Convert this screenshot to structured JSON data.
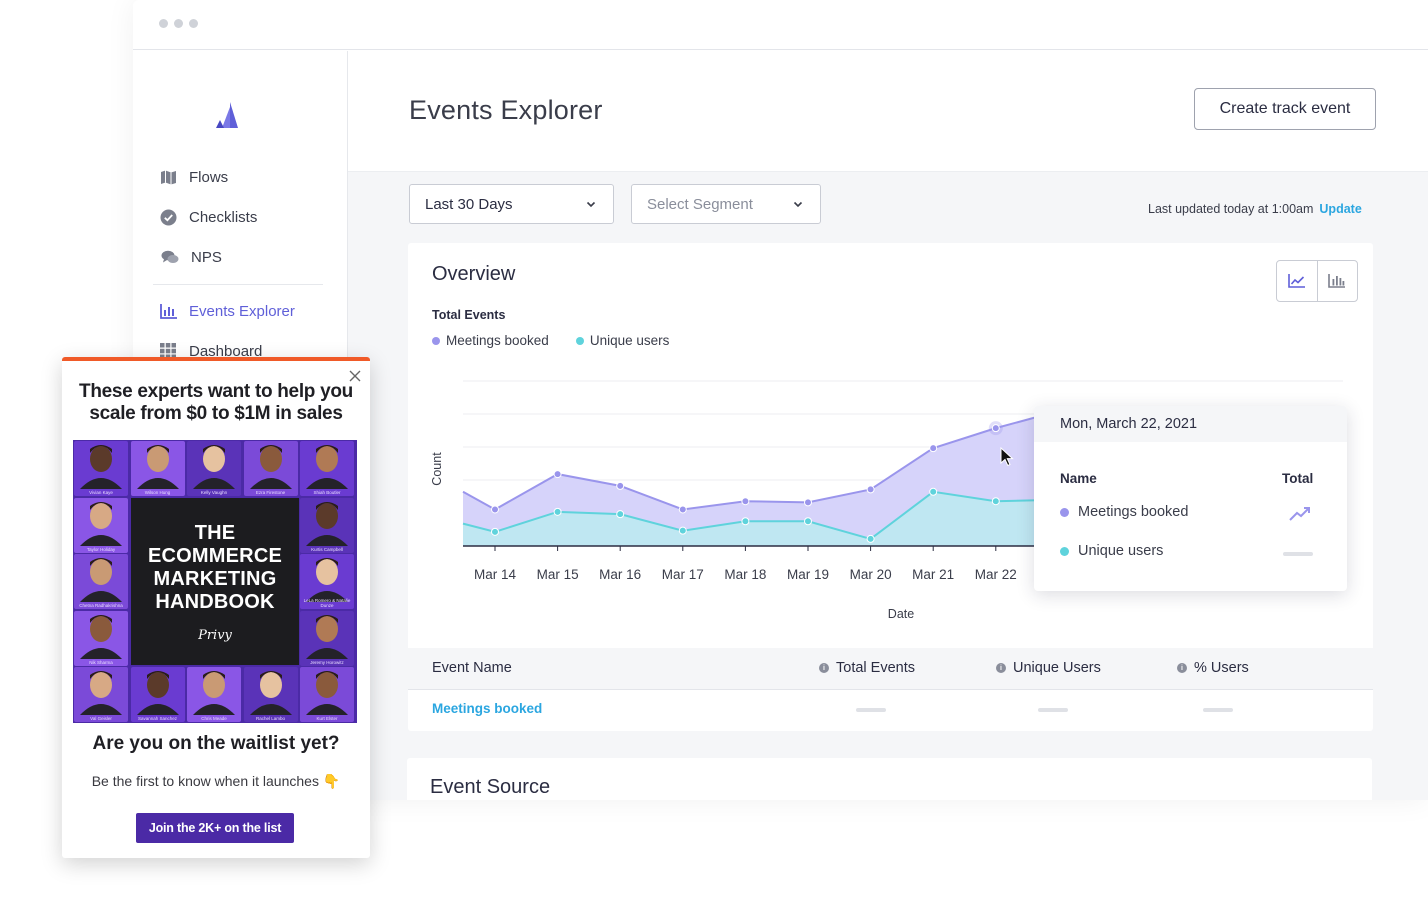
{
  "window": {
    "dots": [
      "#cfd2d8",
      "#cfd2d8",
      "#cfd2d8"
    ]
  },
  "sidebar": {
    "items": [
      {
        "label": "Flows",
        "icon": "map-icon"
      },
      {
        "label": "Checklists",
        "icon": "check-circle-icon"
      },
      {
        "label": "NPS",
        "icon": "chat-bubbles-icon"
      },
      {
        "label": "Events Explorer",
        "icon": "bar-chart-icon",
        "active": true
      },
      {
        "label": "Dashboard",
        "icon": "grid-icon"
      }
    ]
  },
  "header": {
    "title": "Events Explorer",
    "create_button": "Create track event"
  },
  "filters": {
    "date_range": "Last 30 Days",
    "segment_placeholder": "Select Segment",
    "last_updated": "Last updated today at 1:00am",
    "update_link": "Update"
  },
  "overview": {
    "title": "Overview",
    "subtitle": "Total Events",
    "legend": [
      {
        "label": "Meetings booked",
        "color": "#9a95ec"
      },
      {
        "label": "Unique users",
        "color": "#5fd3dc"
      }
    ]
  },
  "chart_data": {
    "type": "area",
    "title": "Total Events",
    "xlabel": "Date",
    "ylabel": "Count",
    "categories": [
      "Mar 14",
      "Mar 15",
      "Mar 16",
      "Mar 17",
      "Mar 18",
      "Mar 19",
      "Mar 20",
      "Mar 21",
      "Mar 22"
    ],
    "series": [
      {
        "name": "Meetings booked",
        "color": "#9a95ec",
        "start": 4.6,
        "values": [
          3.1,
          6.1,
          5.1,
          3.1,
          3.8,
          3.7,
          4.8,
          8.3,
          10.0
        ],
        "end": 11.2
      },
      {
        "name": "Unique users",
        "color": "#5fd3dc",
        "start": 1.9,
        "values": [
          1.2,
          2.9,
          2.7,
          1.3,
          2.1,
          2.1,
          0.6,
          4.6,
          3.8
        ],
        "end": 3.9
      }
    ],
    "ylim": [
      0,
      14
    ],
    "grid": true,
    "legend": "top-left"
  },
  "tooltip": {
    "date": "Mon, March 22, 2021",
    "col_name": "Name",
    "col_total": "Total",
    "rows": [
      {
        "label": "Meetings booked",
        "color": "#9a95ec"
      },
      {
        "label": "Unique users",
        "color": "#5fd3dc"
      }
    ]
  },
  "table": {
    "headers": [
      "Event Name",
      "Total Events",
      "Unique Users",
      "% Users"
    ],
    "rows": [
      {
        "name": "Meetings booked"
      }
    ]
  },
  "event_source": {
    "title": "Event Source"
  },
  "popup": {
    "title": "These experts want to help you scale from $0 to $1M in sales",
    "book_title": "THE ECOMMERCE MARKETING HANDBOOK",
    "book_brand": "Privy",
    "question": "Are you on the waitlist yet?",
    "subtitle": "Be the first to know when it launches 👇",
    "cta": "Join the 2K+ on the list",
    "experts": [
      "Vivian Kaye",
      "Wilson Hung",
      "Kelly Vaughn",
      "Ezra Firestone",
      "Shiah Boutler",
      "Taylor Holiday",
      "Kurtis Campbell",
      "Chetna Radhakrishna",
      "LeLa Romero & Natalie Dunze",
      "Nik Sharma",
      "Jeremy Horowitz",
      "Val Geisler",
      "Savannah Sanchez",
      "Chris Meade",
      "Rachel Lambo",
      "Kurt Elster"
    ],
    "accent": "#4b2aa6",
    "top_border": "#f05a28"
  }
}
